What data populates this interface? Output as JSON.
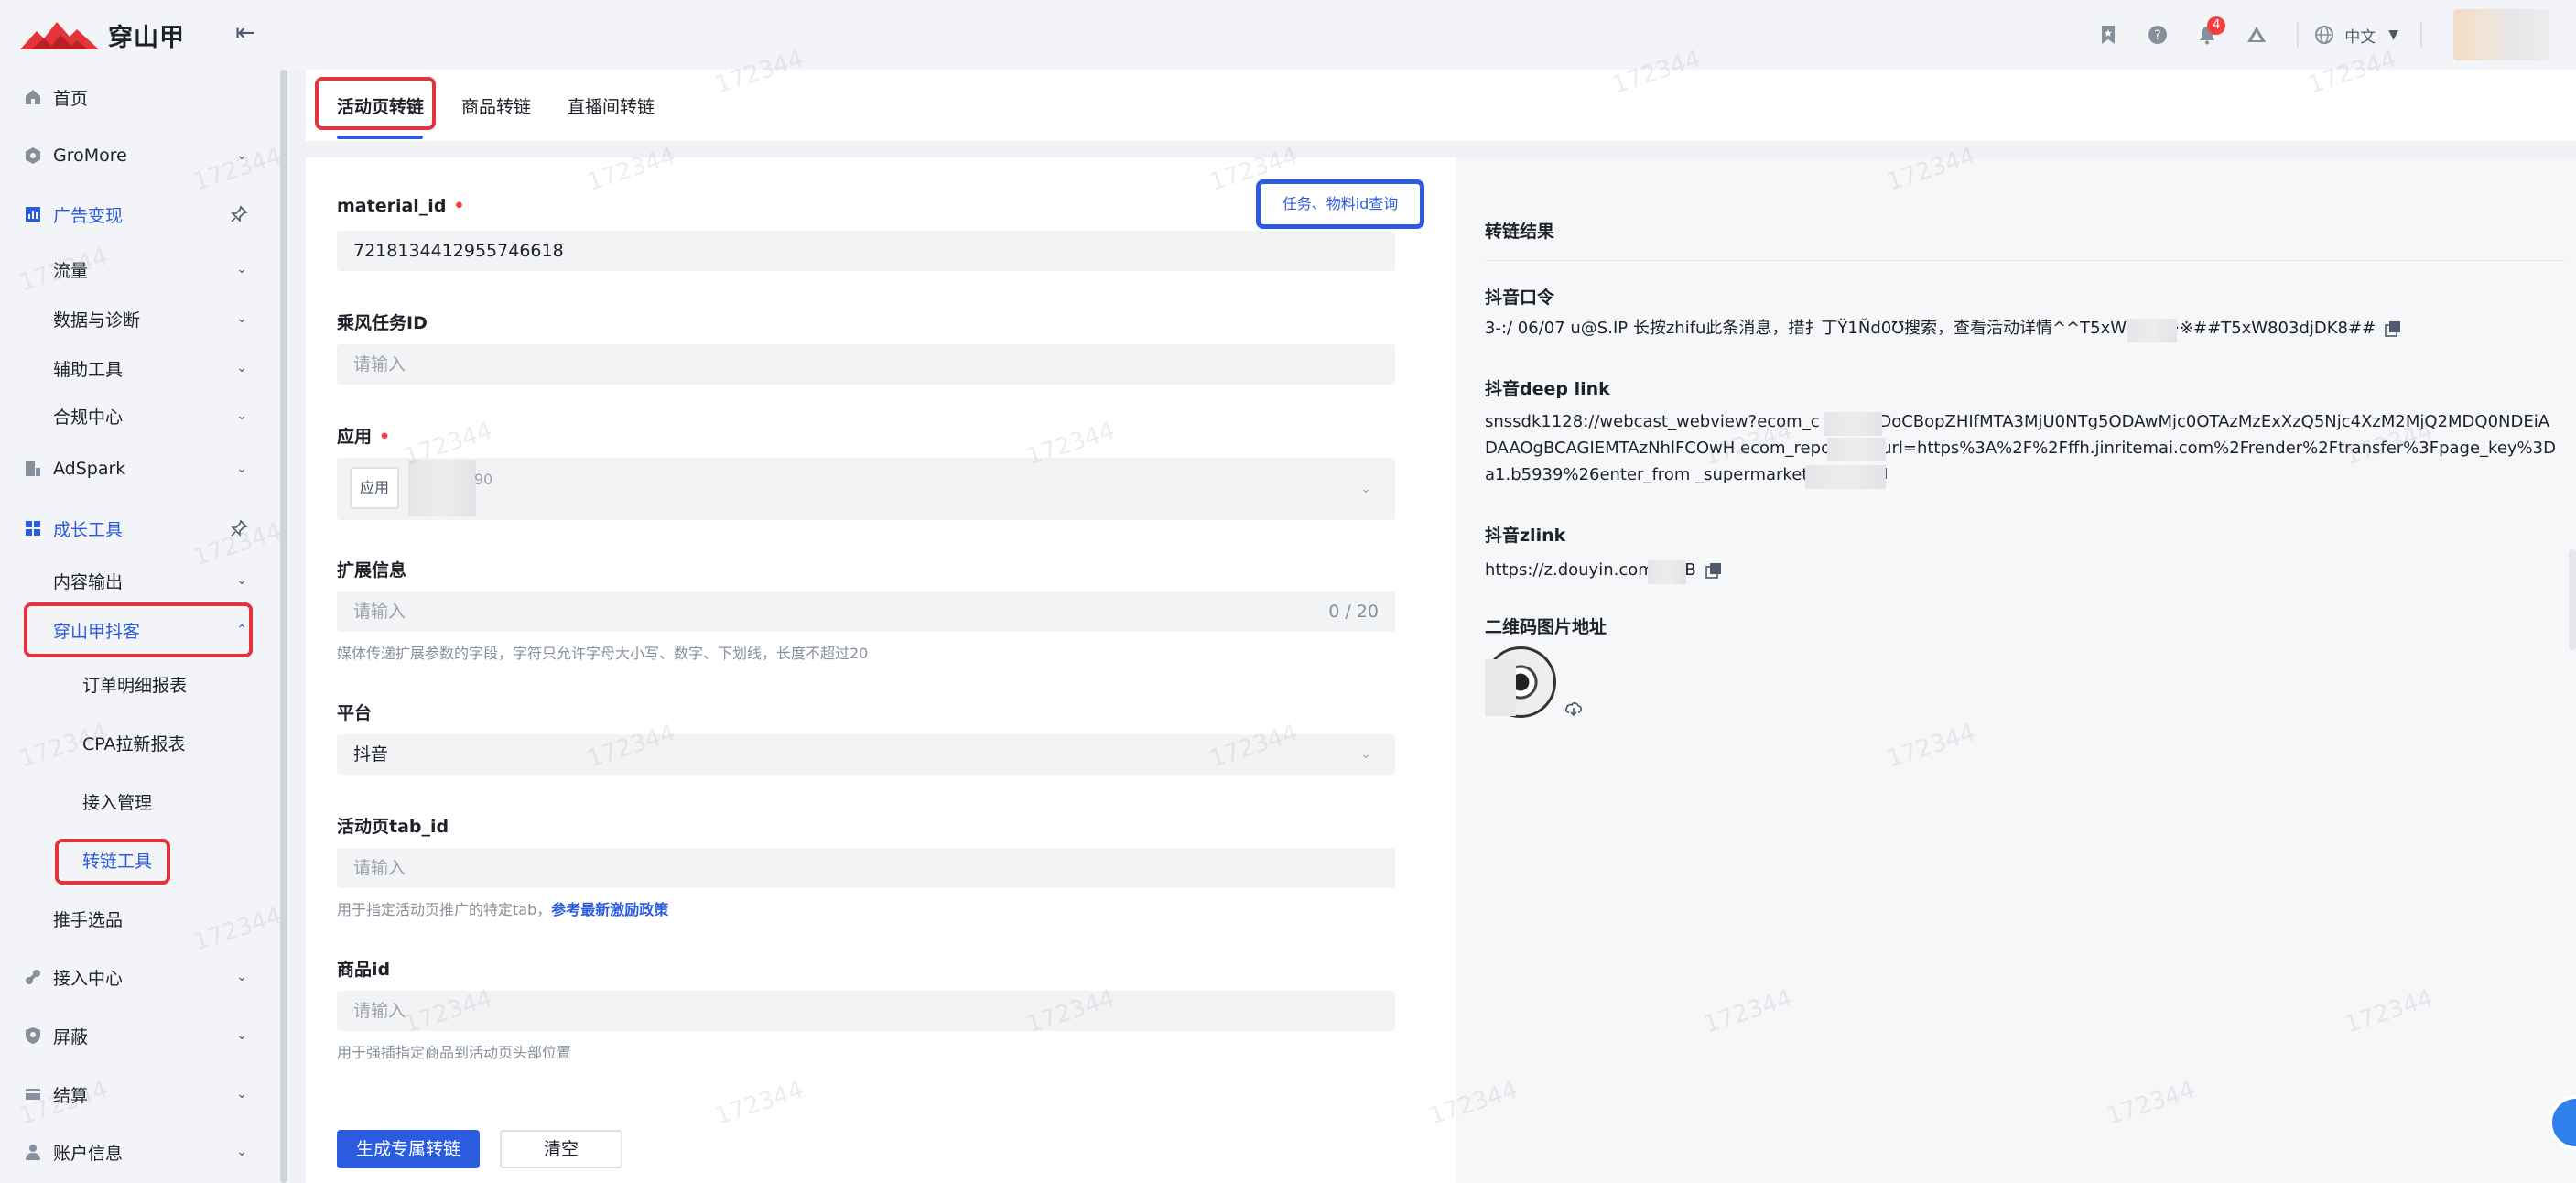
{
  "brand": {
    "name": "穿山甲"
  },
  "header": {
    "language": "中文",
    "notification_count": "4",
    "icons": [
      "bookmark-icon",
      "help-icon",
      "bell-icon",
      "triangle-icon",
      "globe-icon"
    ]
  },
  "sidebar": {
    "items": [
      {
        "label": "首页",
        "icon": "home-icon"
      },
      {
        "label": "GroMore",
        "icon": "hexagon-icon"
      },
      {
        "label": "广告变现",
        "icon": "chart-icon"
      },
      {
        "label": "流量"
      },
      {
        "label": "数据与诊断"
      },
      {
        "label": "辅助工具"
      },
      {
        "label": "合规中心"
      },
      {
        "label": "AdSpark",
        "icon": "doc-chart-icon"
      },
      {
        "label": "成长工具",
        "icon": "grid-icon"
      },
      {
        "label": "内容输出"
      },
      {
        "label": "穿山甲抖客"
      },
      {
        "label": "订单明细报表"
      },
      {
        "label": "CPA拉新报表"
      },
      {
        "label": "接入管理"
      },
      {
        "label": "转链工具"
      },
      {
        "label": "推手选品"
      },
      {
        "label": "接入中心",
        "icon": "link-icon"
      },
      {
        "label": "屏蔽",
        "icon": "shield-icon"
      },
      {
        "label": "结算",
        "icon": "wallet-icon"
      },
      {
        "label": "账户信息",
        "icon": "user-icon"
      }
    ]
  },
  "tabs": [
    {
      "label": "活动页转链",
      "active": true
    },
    {
      "label": "商品转链"
    },
    {
      "label": "直播间转链"
    }
  ],
  "form": {
    "query_button": "任务、物料id查询",
    "material_id": {
      "label": "material_id",
      "value": "7218134412955746618"
    },
    "task_id": {
      "label": "乘风任务ID",
      "placeholder": "请输入"
    },
    "app": {
      "label": "应用",
      "tag": "应用",
      "value_suffix": "90"
    },
    "ext": {
      "label": "扩展信息",
      "placeholder": "请输入",
      "count": "0 / 20",
      "hint": "媒体传递扩展参数的字段，字符只允许字母大小写、数字、下划线，长度不超过20"
    },
    "platform": {
      "label": "平台",
      "value": "抖音"
    },
    "tab_id": {
      "label": "活动页tab_id",
      "placeholder": "请输入",
      "hint": "用于指定活动页推广的特定tab，",
      "hint_link": "参考最新激励政策"
    },
    "product_id": {
      "label": "商品id",
      "placeholder": "请输入",
      "hint": "用于强插指定商品到活动页头部位置"
    },
    "submit": "生成专属转链",
    "clear": "清空"
  },
  "result": {
    "title": "转链结果",
    "command_label": "抖音口令",
    "command_value": "3-:/ 06/07 u@S.IP 长按zhifu此条消息，措扌丁Ÿ1Ňd0Ʊ搜索，查看活动详情^^T5xW DK8※※##T5xW803djDK8##",
    "deeplink_label": "抖音deep link",
    "deeplink_value": "snssdk1128://webcast_webview?ecom_c Cj4IABDoCBopZHIfMTA3MjU0NTg5ODAwMjc0OTAzMzExXzQ5Njc4XzM2MjQ2MDQ0NDEiADAAOgBCAGIEMTAzNhlFCOwH ecom_report=1&url=https%3A%2F%2Fffh.jinritemai.com%2Frender%2Ftransfer%3Fpage_key%3Da1.b5939%26enter_from _supermarket_share",
    "zlink_label": "抖音zlink",
    "zlink_value": "https://z.douyin.com Sj0B",
    "qr_label": "二维码图片地址"
  },
  "watermark": "172344",
  "colors": {
    "primary": "#2b5ce0",
    "highlight_red": "#e5333b",
    "highlight_blue": "#2b5ce0"
  }
}
